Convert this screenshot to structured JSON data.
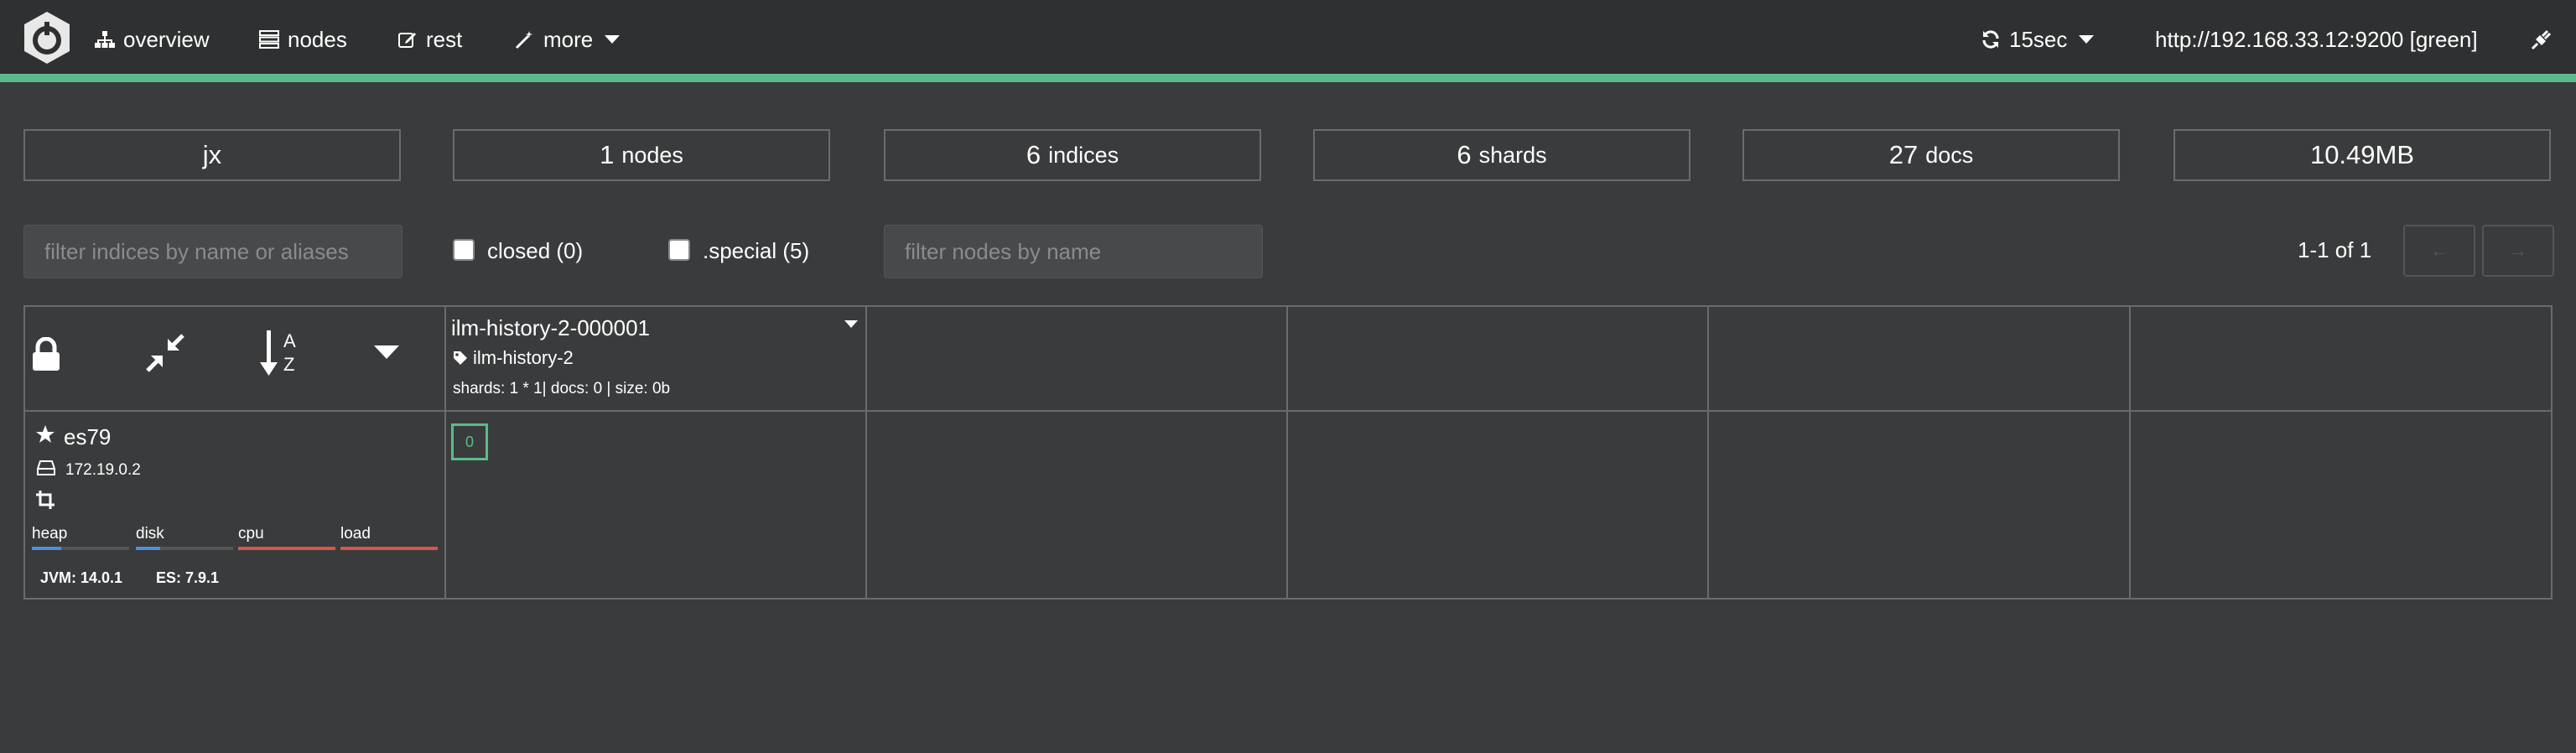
{
  "nav": {
    "overview": "overview",
    "nodes": "nodes",
    "rest": "rest",
    "more": "more",
    "refresh": "15sec",
    "cluster": "http://192.168.33.12:9200 [green]"
  },
  "stats": {
    "cluster_name": "jx",
    "nodes_count": "1",
    "nodes_unit": "nodes",
    "indices_count": "6",
    "indices_unit": "indices",
    "shards_count": "6",
    "shards_unit": "shards",
    "docs_count": "27",
    "docs_unit": "docs",
    "size": "10.49MB"
  },
  "filters": {
    "indices_placeholder": "filter indices by name or aliases",
    "closed_label": "closed (0)",
    "special_label": ".special (5)",
    "nodes_placeholder": "filter nodes by name",
    "pager": "1-1 of 1",
    "prev": "←",
    "next": "→"
  },
  "index": {
    "name": "ilm-history-2-000001",
    "alias": "ilm-history-2",
    "stats": "shards: 1 * 1| docs: 0 | size: 0b"
  },
  "node": {
    "name": "es79",
    "ip": "172.19.0.2",
    "metrics": [
      {
        "label": "heap",
        "color": "#4a90d9",
        "fraction": 0.3
      },
      {
        "label": "disk",
        "color": "#4a90d9",
        "fraction": 0.25
      },
      {
        "label": "cpu",
        "color": "#d9534f",
        "fraction": 1.0
      },
      {
        "label": "load",
        "color": "#d9534f",
        "fraction": 1.0
      }
    ],
    "jvm": "JVM: 14.0.1",
    "es": "ES: 7.9.1",
    "shard": "0"
  },
  "colors": {
    "accent": "#5cbb8a",
    "background": "#3a3b3c",
    "navbar": "#2f3031"
  }
}
